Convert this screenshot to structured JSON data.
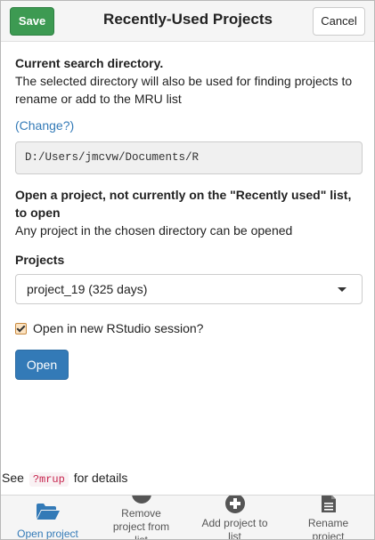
{
  "header": {
    "save_label": "Save",
    "title": "Recently-Used Projects",
    "cancel_label": "Cancel"
  },
  "search_dir": {
    "heading": "Current search directory.",
    "description": "The selected directory will also be used for finding projects to rename or add to the MRU list",
    "change_link": "(Change?)",
    "path": "D:/Users/jmcvw/Documents/R"
  },
  "open_section": {
    "heading": "Open a project, not currently on the \"Recently used\" list, to open",
    "description": "Any project in the chosen directory can be opened",
    "projects_label": "Projects",
    "selected_project": "project_19 (325 days)",
    "new_session_label": "Open in new RStudio session?",
    "new_session_checked": true,
    "open_button": "Open"
  },
  "footer_note": {
    "prefix": "See",
    "code": "?mrup",
    "suffix": "for details"
  },
  "tabs": [
    {
      "label": "Open project",
      "icon": "folder-open-icon",
      "active": true
    },
    {
      "label": "Remove project from list",
      "icon": "minus-circle-icon",
      "active": false
    },
    {
      "label": "Add project to list",
      "icon": "plus-circle-icon",
      "active": false
    },
    {
      "label": "Rename project",
      "icon": "file-icon",
      "active": false
    }
  ],
  "colors": {
    "save": "#3d9a52",
    "primary": "#337ab7",
    "code": "#c7254e"
  }
}
